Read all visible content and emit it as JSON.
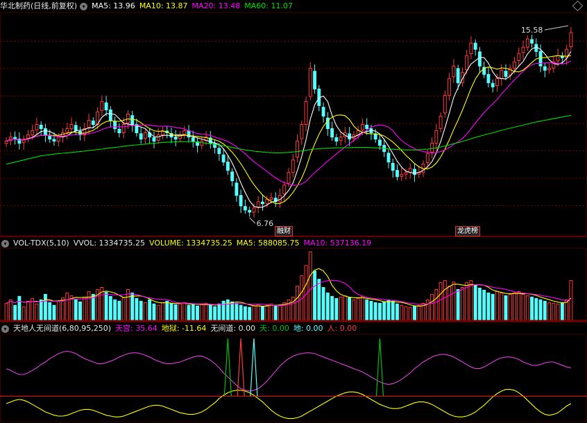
{
  "header1": {
    "title": "华北制药(日线,前复权)",
    "ma5": "MA5: 13.96",
    "ma10": "MA10: 13.87",
    "ma20": "MA20: 13.48",
    "ma60": "MA60: 11.07"
  },
  "header2": {
    "name": "VOL-TDX(5,10)",
    "vvol": "VVOL: 1334735.25",
    "volume": "VOLUME: 1334735.25",
    "ma5": "MA5: 588085.75",
    "ma10": "MA10: 537136.19"
  },
  "header3": {
    "name": "天地人无间道(6,80,95,250)",
    "tiangong": "天宫: 35.64",
    "diyu": "地狱: -11.64",
    "wujiandao": "无间道: 0.00",
    "tian": "天: 0.00",
    "di": "地: 0.00",
    "ren": "人: 0.00"
  },
  "tags": {
    "left": "融财",
    "right": "龙虎榜"
  },
  "colors": {
    "up": "#ff3b3b",
    "down": "#54ffff",
    "ma5": "#ffffff",
    "ma10": "#ffff00",
    "ma20": "#ff00ff",
    "ma60": "#00e000",
    "grid": "#7a0000"
  },
  "chart_data": {
    "type": "candlestick",
    "price_ylim": [
      6.0,
      16.5
    ],
    "high_label": "15.58",
    "low_label": "6.76",
    "close": [
      10.4,
      10.6,
      10.5,
      10.3,
      10.5,
      10.7,
      10.9,
      11.2,
      11.0,
      10.7,
      10.5,
      10.4,
      10.6,
      10.8,
      11.0,
      11.2,
      10.9,
      10.7,
      11.0,
      11.4,
      11.2,
      11.8,
      12.3,
      11.9,
      11.4,
      11.0,
      10.8,
      11.2,
      11.7,
      11.2,
      10.8,
      10.5,
      10.8,
      10.6,
      10.4,
      10.7,
      10.9,
      10.8,
      10.6,
      10.5,
      10.7,
      10.9,
      10.6,
      10.4,
      10.2,
      10.4,
      10.6,
      10.3,
      10.1,
      9.8,
      9.4,
      9.0,
      8.5,
      7.8,
      7.3,
      7.1,
      7.0,
      7.2,
      7.5,
      7.4,
      7.6,
      7.7,
      7.5,
      7.8,
      8.3,
      8.9,
      9.5,
      10.4,
      11.2,
      12.3,
      13.9,
      12.9,
      12.1,
      11.6,
      11.0,
      10.6,
      10.4,
      10.6,
      10.8,
      10.5,
      10.7,
      10.9,
      11.2,
      11.0,
      10.8,
      10.5,
      10.2,
      9.9,
      9.4,
      9.0,
      8.7,
      8.8,
      8.9,
      9.1,
      8.8,
      8.9,
      9.3,
      9.8,
      10.3,
      10.9,
      11.6,
      12.6,
      13.4,
      14.0,
      13.2,
      13.7,
      14.5,
      15.1,
      14.8,
      14.0,
      13.6,
      13.2,
      13.0,
      13.4,
      13.8,
      13.5,
      13.9,
      14.2,
      14.6,
      14.9,
      15.3,
      15.1,
      14.7,
      14.0,
      13.8,
      13.9,
      14.2,
      14.5,
      14.4,
      14.8,
      15.6
    ],
    "ma60": [
      9.3,
      9.35,
      9.4,
      9.45,
      9.5,
      9.55,
      9.6,
      9.65,
      9.7,
      9.72,
      9.75,
      9.78,
      9.8,
      9.82,
      9.84,
      9.86,
      9.88,
      9.9,
      9.92,
      9.95,
      9.97,
      10.0,
      10.02,
      10.05,
      10.08,
      10.1,
      10.12,
      10.15,
      10.18,
      10.2,
      10.22,
      10.24,
      10.26,
      10.28,
      10.3,
      10.32,
      10.34,
      10.35,
      10.36,
      10.37,
      10.38,
      10.38,
      10.38,
      10.37,
      10.35,
      10.33,
      10.3,
      10.28,
      10.25,
      10.22,
      10.18,
      10.14,
      10.1,
      10.06,
      10.02,
      9.98,
      9.95,
      9.92,
      9.9,
      9.88,
      9.86,
      9.85,
      9.84,
      9.84,
      9.85,
      9.86,
      9.88,
      9.9,
      9.93,
      9.96,
      10.0,
      10.02,
      10.04,
      10.05,
      10.06,
      10.07,
      10.08,
      10.08,
      10.09,
      10.09,
      10.1,
      10.1,
      10.1,
      10.1,
      10.09,
      10.08,
      10.07,
      10.05,
      10.03,
      10.01,
      10.0,
      9.99,
      9.98,
      9.98,
      9.98,
      9.99,
      10.0,
      10.02,
      10.05,
      10.08,
      10.12,
      10.17,
      10.22,
      10.28,
      10.33,
      10.39,
      10.45,
      10.52,
      10.58,
      10.64,
      10.7,
      10.75,
      10.8,
      10.86,
      10.92,
      10.97,
      11.02,
      11.07,
      11.12,
      11.17,
      11.22,
      11.27,
      11.32,
      11.36,
      11.4,
      11.44,
      11.48,
      11.52,
      11.56,
      11.6,
      11.64
    ],
    "volume": [
      0.25,
      0.3,
      0.22,
      0.35,
      0.2,
      0.28,
      0.32,
      0.24,
      0.3,
      0.38,
      0.26,
      0.22,
      0.28,
      0.33,
      0.4,
      0.36,
      0.31,
      0.27,
      0.34,
      0.42,
      0.38,
      0.45,
      0.48,
      0.41,
      0.35,
      0.3,
      0.28,
      0.33,
      0.45,
      0.4,
      0.32,
      0.28,
      0.26,
      0.3,
      0.24,
      0.22,
      0.26,
      0.28,
      0.25,
      0.23,
      0.24,
      0.26,
      0.22,
      0.24,
      0.21,
      0.23,
      0.25,
      0.22,
      0.2,
      0.24,
      0.28,
      0.3,
      0.27,
      0.25,
      0.22,
      0.2,
      0.19,
      0.21,
      0.23,
      0.2,
      0.22,
      0.24,
      0.21,
      0.23,
      0.26,
      0.3,
      0.34,
      0.5,
      0.65,
      0.8,
      1.0,
      0.72,
      0.6,
      0.48,
      0.4,
      0.35,
      0.32,
      0.34,
      0.36,
      0.33,
      0.3,
      0.32,
      0.35,
      0.3,
      0.28,
      0.26,
      0.25,
      0.27,
      0.3,
      0.28,
      0.24,
      0.22,
      0.2,
      0.19,
      0.21,
      0.22,
      0.25,
      0.3,
      0.38,
      0.45,
      0.55,
      0.58,
      0.5,
      0.56,
      0.45,
      0.48,
      0.55,
      0.58,
      0.52,
      0.47,
      0.44,
      0.4,
      0.38,
      0.42,
      0.4,
      0.36,
      0.38,
      0.4,
      0.42,
      0.38,
      0.36,
      0.34,
      0.32,
      0.3,
      0.28,
      0.26,
      0.25,
      0.24,
      0.26,
      0.3,
      0.58
    ],
    "ind_purple": [
      0.62,
      0.6,
      0.57,
      0.55,
      0.55,
      0.57,
      0.6,
      0.63,
      0.67,
      0.7,
      0.74,
      0.77,
      0.8,
      0.82,
      0.83,
      0.82,
      0.8,
      0.77,
      0.74,
      0.72,
      0.7,
      0.68,
      0.68,
      0.69,
      0.71,
      0.73,
      0.76,
      0.78,
      0.8,
      0.81,
      0.81,
      0.8,
      0.78,
      0.76,
      0.73,
      0.71,
      0.69,
      0.68,
      0.68,
      0.69,
      0.7,
      0.72,
      0.74,
      0.76,
      0.77,
      0.77,
      0.75,
      0.72,
      0.68,
      0.63,
      0.57,
      0.52,
      0.47,
      0.42,
      0.38,
      0.36,
      0.35,
      0.36,
      0.38,
      0.42,
      0.47,
      0.53,
      0.59,
      0.65,
      0.7,
      0.74,
      0.77,
      0.79,
      0.8,
      0.81,
      0.81,
      0.8,
      0.78,
      0.76,
      0.74,
      0.72,
      0.7,
      0.68,
      0.66,
      0.64,
      0.62,
      0.6,
      0.58,
      0.55,
      0.52,
      0.49,
      0.46,
      0.44,
      0.43,
      0.44,
      0.46,
      0.49,
      0.53,
      0.57,
      0.62,
      0.66,
      0.7,
      0.73,
      0.76,
      0.78,
      0.79,
      0.79,
      0.78,
      0.76,
      0.73,
      0.7,
      0.67,
      0.64,
      0.62,
      0.62,
      0.64,
      0.67,
      0.7,
      0.73,
      0.75,
      0.76,
      0.76,
      0.75,
      0.73,
      0.7,
      0.68,
      0.66,
      0.66,
      0.67,
      0.69,
      0.7,
      0.7,
      0.68,
      0.66,
      0.64,
      0.63
    ],
    "ind_yellow": [
      0.2,
      0.22,
      0.24,
      0.25,
      0.24,
      0.22,
      0.19,
      0.16,
      0.13,
      0.1,
      0.08,
      0.06,
      0.05,
      0.05,
      0.06,
      0.08,
      0.1,
      0.12,
      0.13,
      0.13,
      0.12,
      0.1,
      0.08,
      0.06,
      0.05,
      0.04,
      0.04,
      0.05,
      0.07,
      0.09,
      0.11,
      0.13,
      0.15,
      0.17,
      0.18,
      0.18,
      0.17,
      0.15,
      0.13,
      0.11,
      0.09,
      0.08,
      0.07,
      0.07,
      0.08,
      0.1,
      0.13,
      0.17,
      0.21,
      0.26,
      0.3,
      0.33,
      0.35,
      0.36,
      0.36,
      0.35,
      0.33,
      0.3,
      0.26,
      0.22,
      0.17,
      0.12,
      0.08,
      0.05,
      0.03,
      0.02,
      0.02,
      0.03,
      0.05,
      0.08,
      0.11,
      0.14,
      0.17,
      0.2,
      0.23,
      0.26,
      0.29,
      0.31,
      0.33,
      0.34,
      0.34,
      0.33,
      0.31,
      0.28,
      0.25,
      0.22,
      0.19,
      0.17,
      0.15,
      0.14,
      0.14,
      0.15,
      0.17,
      0.19,
      0.21,
      0.22,
      0.22,
      0.21,
      0.19,
      0.16,
      0.13,
      0.1,
      0.07,
      0.05,
      0.04,
      0.04,
      0.05,
      0.07,
      0.1,
      0.14,
      0.18,
      0.23,
      0.28,
      0.32,
      0.35,
      0.37,
      0.37,
      0.36,
      0.33,
      0.29,
      0.24,
      0.19,
      0.14,
      0.1,
      0.07,
      0.06,
      0.07,
      0.09,
      0.13,
      0.17,
      0.2
    ],
    "signals": [
      {
        "idx": 51,
        "color": "#00c000"
      },
      {
        "idx": 54,
        "color": "#ff3b3b"
      },
      {
        "idx": 57,
        "color": "#54ffff"
      },
      {
        "idx": 86,
        "color": "#00c000"
      }
    ]
  }
}
